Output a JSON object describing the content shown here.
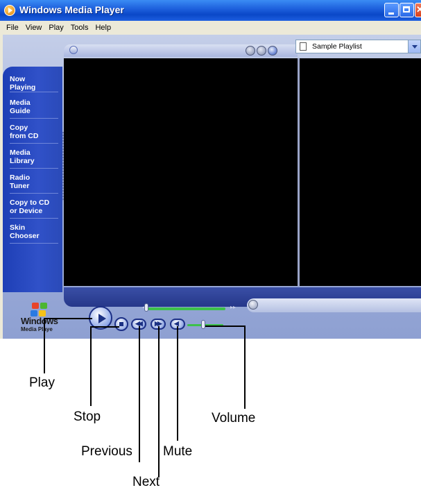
{
  "window": {
    "title": "Windows Media Player",
    "menu": [
      "File",
      "View",
      "Play",
      "Tools",
      "Help"
    ]
  },
  "player": {
    "taskbar": [
      {
        "label": "Now\nPlaying",
        "selected": true
      },
      {
        "label": "Media\nGuide"
      },
      {
        "label": "Copy\nfrom CD"
      },
      {
        "label": "Media\nLibrary"
      },
      {
        "label": "Radio\nTuner"
      },
      {
        "label": "Copy to CD\nor Device"
      },
      {
        "label": "Skin\nChooser"
      }
    ],
    "playlist": "Sample Playlist",
    "logo": {
      "text": "Windows",
      "sub": "Media Playe"
    }
  },
  "callouts": {
    "play": "Play",
    "stop": "Stop",
    "previous": "Previous",
    "mute": "Mute",
    "next": "Next",
    "volume": "Volume"
  },
  "colors": {
    "titlebar": "#1f62de",
    "taskpane": "#2a4ab8",
    "seek": "#3cc14a"
  }
}
